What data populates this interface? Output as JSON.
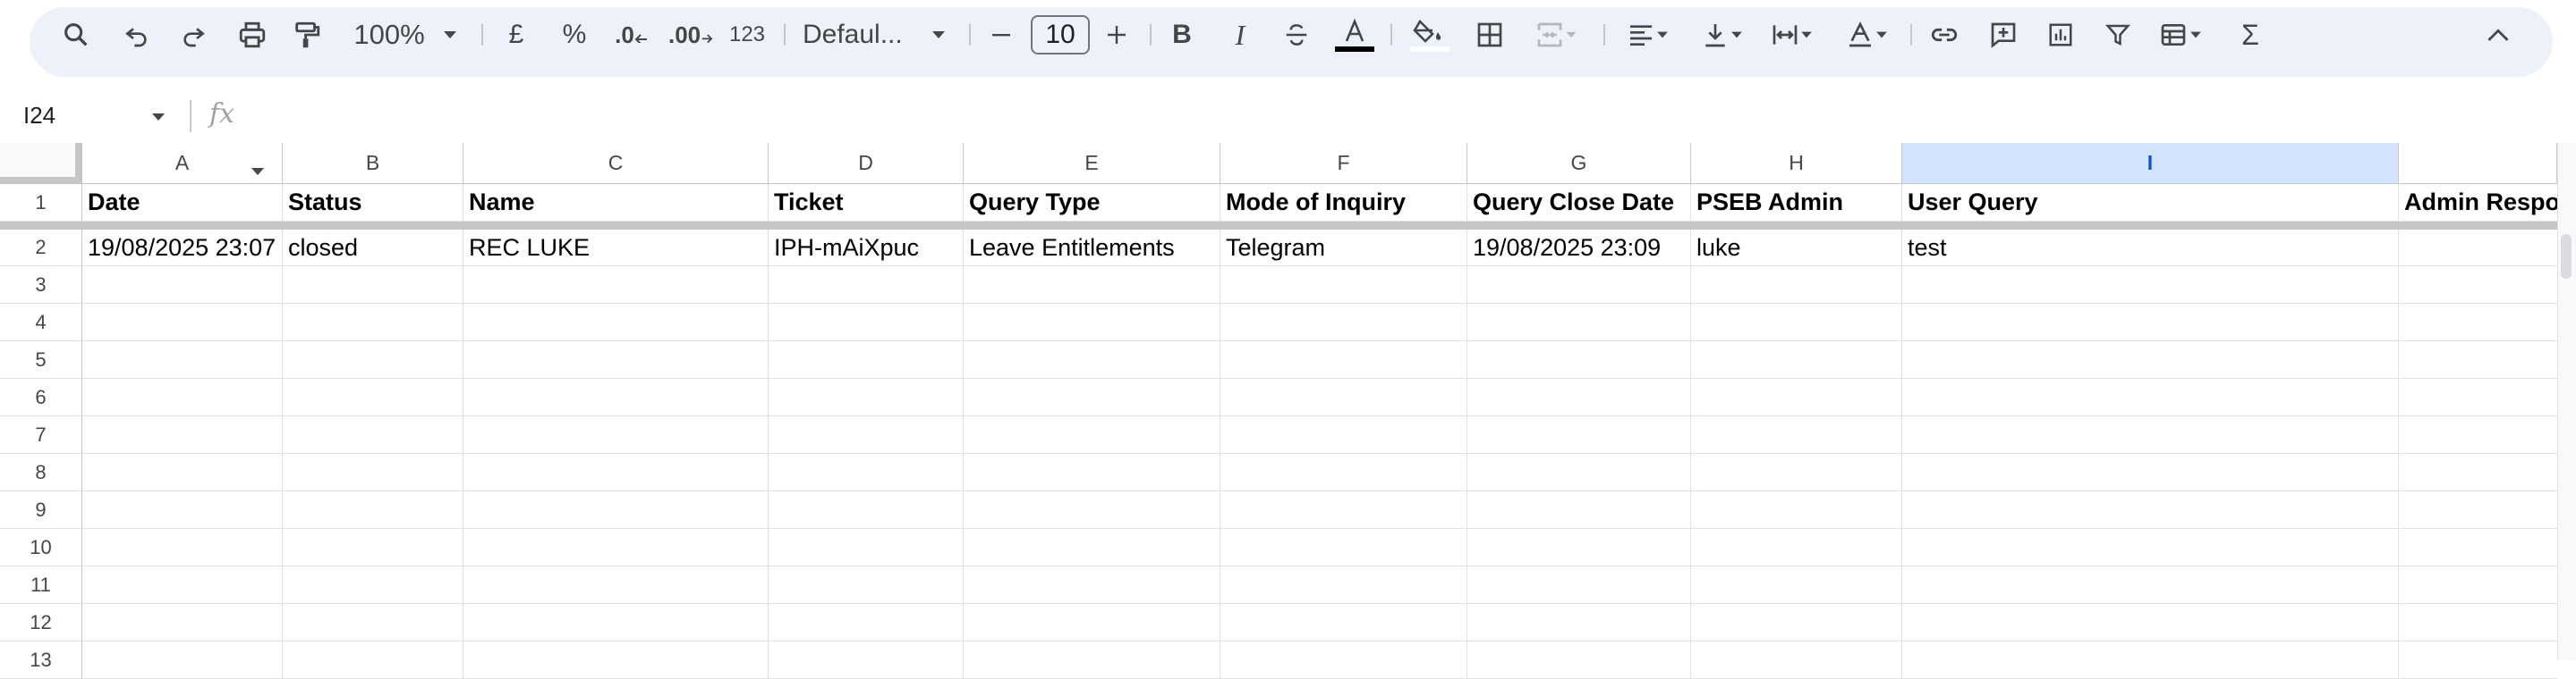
{
  "toolbar": {
    "zoom": "100%",
    "currency": "£",
    "percent": "%",
    "decrease_decimal": ".0",
    "increase_decimal": ".00",
    "more_formats": "123",
    "font_name": "Defaul...",
    "font_size": "10",
    "text_color": "#000000",
    "fill_color": "#ffffff",
    "icons": [
      "search-icon",
      "undo-icon",
      "redo-icon",
      "print-icon",
      "paint-format-icon",
      "zoom-dropdown-icon",
      "currency-icon",
      "percent-icon",
      "decrease-decimal-icon",
      "increase-decimal-icon",
      "more-formats-icon",
      "font-dropdown-icon",
      "minus-icon",
      "plus-icon",
      "bold-icon",
      "italic-icon",
      "strikethrough-icon",
      "text-color-icon",
      "fill-color-icon",
      "borders-icon",
      "merge-cells-icon",
      "align-icon",
      "vertical-align-icon",
      "text-wrap-icon",
      "text-rotation-icon",
      "link-icon",
      "comment-icon",
      "chart-icon",
      "filter-icon",
      "table-icon",
      "functions-icon",
      "collapse-icon"
    ]
  },
  "formula_bar": {
    "name_box": "I24",
    "fx": "fx",
    "value": ""
  },
  "grid": {
    "columns": [
      "A",
      "B",
      "C",
      "D",
      "E",
      "F",
      "G",
      "H",
      "I"
    ],
    "selected_column": "I",
    "selection_color": "#d3e3fd",
    "row_numbers": [
      "1",
      "2",
      "3",
      "4",
      "5",
      "6",
      "7",
      "8",
      "9",
      "10",
      "11",
      "12",
      "13"
    ],
    "header_row": [
      "Date",
      "Status",
      "Name",
      "Ticket",
      "Query Type",
      "Mode of Inquiry",
      "Query Close Date",
      "PSEB Admin",
      "User Query",
      "Admin Respo"
    ],
    "rows": [
      [
        "19/08/2025 23:07",
        "closed",
        "REC LUKE",
        "IPH-mAiXpuc",
        "Leave Entitlements",
        "Telegram",
        "19/08/2025 23:09",
        "luke",
        "test",
        ""
      ]
    ]
  }
}
